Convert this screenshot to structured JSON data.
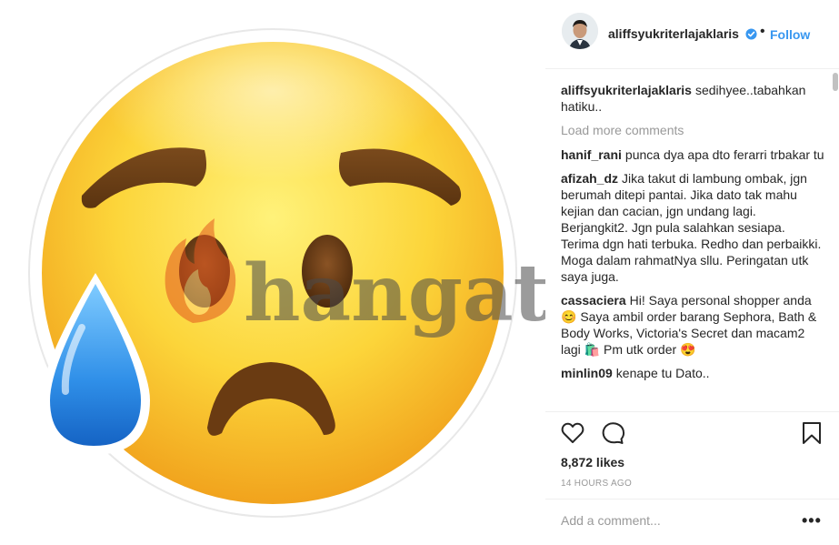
{
  "post": {
    "username": "aliffsyukriterlajaklaris",
    "follow_label": "Follow",
    "separator": "•"
  },
  "watermark": {
    "text": "hangat.com"
  },
  "caption": {
    "username": "aliffsyukriterlajaklaris",
    "text": "sedihyee..tabahkan hatiku.."
  },
  "load_more_label": "Load more comments",
  "comments": [
    {
      "username": "hanif_rani",
      "text": "punca dya apa dto ferarri trbakar tu"
    },
    {
      "username": "afizah_dz",
      "text": "Jika takut di lambung ombak, jgn berumah ditepi pantai. Jika dato tak mahu kejian dan cacian, jgn undang lagi. Berjangkit2. Jgn pula salahkan sesiapa. Terima dgn hati terbuka. Redho dan perbaikki. Moga dalam rahmatNya sllu. Peringatan utk saya juga."
    },
    {
      "username": "cassaciera",
      "text": "Hi! Saya personal shopper anda 😊 Saya ambil order barang Sephora, Bath & Body Works, Victoria's Secret dan macam2 lagi 🛍️ Pm utk order 😍"
    },
    {
      "username": "minlin09",
      "text": "kenape tu Dato.."
    }
  ],
  "likes_label": "8,872 likes",
  "timestamp": "14 HOURS AGO",
  "add_comment_placeholder": "Add a comment...",
  "more_options_label": "•••",
  "icons": {
    "like": "heart-icon",
    "comment": "comment-bubble-icon",
    "save": "bookmark-icon",
    "verified": "verified-badge-icon"
  },
  "colors": {
    "link": "#3897f0",
    "muted": "#999999",
    "text": "#262626",
    "verified": "#3897f0"
  }
}
